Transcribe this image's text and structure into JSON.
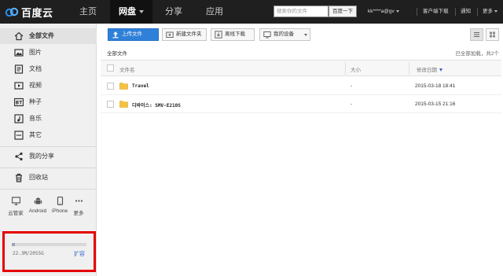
{
  "topbar": {
    "brand": "百度云",
    "tabs": [
      {
        "label": "主页"
      },
      {
        "label": "网盘"
      },
      {
        "label": "分享"
      },
      {
        "label": "应用"
      }
    ],
    "search_placeholder": "搜索你的文件",
    "search_button": "百度一下",
    "user": "kk****a@gv",
    "client_download": "客户端下载",
    "notifications": "通知",
    "more": "更多"
  },
  "sidebar": {
    "items": [
      {
        "label": "全部文件",
        "icon": "home-icon"
      },
      {
        "label": "图片",
        "icon": "image-icon"
      },
      {
        "label": "文档",
        "icon": "document-icon"
      },
      {
        "label": "视频",
        "icon": "video-icon"
      },
      {
        "label": "种子",
        "icon": "bt-icon"
      },
      {
        "label": "音乐",
        "icon": "music-icon"
      },
      {
        "label": "其它",
        "icon": "more-dots-icon"
      }
    ],
    "my_share": "我的分享",
    "recycle_bin": "回收站",
    "devices": [
      {
        "label": "云管家",
        "icon": "monitor-icon"
      },
      {
        "label": "Android",
        "icon": "android-icon"
      },
      {
        "label": "iPhone",
        "icon": "phone-icon"
      },
      {
        "label": "更多",
        "icon": "ellipsis-icon"
      }
    ],
    "quota": {
      "text": "22.3M/2055G",
      "used_fraction": 0.01,
      "expand": "扩容"
    }
  },
  "toolbar": {
    "upload": "上传文件",
    "new_folder": "新建文件夹",
    "offline_download": "离线下载",
    "my_devices": "我的设备"
  },
  "breadcrumb": "全部文件",
  "loaded_status": "已全部加载，共2个",
  "table": {
    "headers": {
      "name": "文件名",
      "size": "大小",
      "modified": "修改日期"
    },
    "rows": [
      {
        "name": "Travel",
        "size": "-",
        "modified": "2015-03-18 18:41"
      },
      {
        "name": "디바이스: SMV-E210S",
        "size": "-",
        "modified": "2015-03-15 21:16"
      }
    ]
  },
  "colors": {
    "topbar_bg": "#1f1f1f",
    "primary_button": "#2f80d8",
    "highlight_box": "#e60000",
    "folder": "#f5c342"
  }
}
